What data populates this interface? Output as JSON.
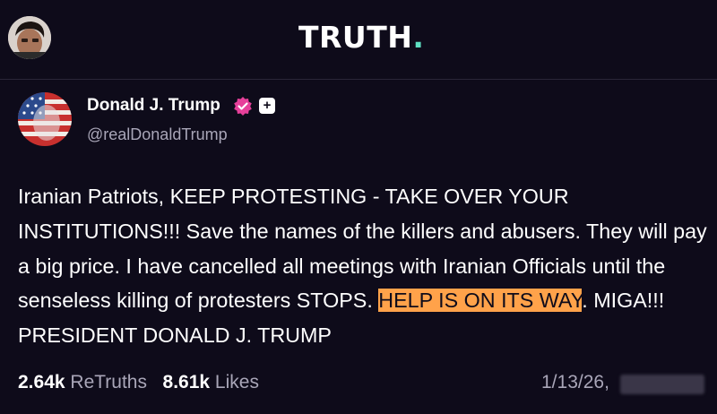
{
  "header": {
    "logo_text": "TRUTH",
    "logo_dot": ".",
    "logo_dot_color": "#5ee0c2"
  },
  "post": {
    "author_name": "Donald J. Trump",
    "author_handle": "@realDonaldTrump",
    "follow_symbol": "+",
    "body_before_highlight": "Iranian Patriots, KEEP PROTESTING - TAKE OVER YOUR INSTITUTIONS!!! Save the names of the killers and abusers. They will pay a big price. I have cancelled all meetings with Iranian Officials until the senseless killing of protesters STOPS. ",
    "body_highlight": "HELP IS ON ITS WAY",
    "body_after_highlight": ". MIGA!!! PRESIDENT DONALD J. TRUMP",
    "highlight_color": "#ffa24a",
    "retruths_count": "2.64k",
    "retruths_label": "ReTruths",
    "likes_count": "8.61k",
    "likes_label": "Likes",
    "date": "1/13/26,"
  },
  "icons": {
    "verified": "verified-badge-icon",
    "follow": "plus-icon"
  }
}
